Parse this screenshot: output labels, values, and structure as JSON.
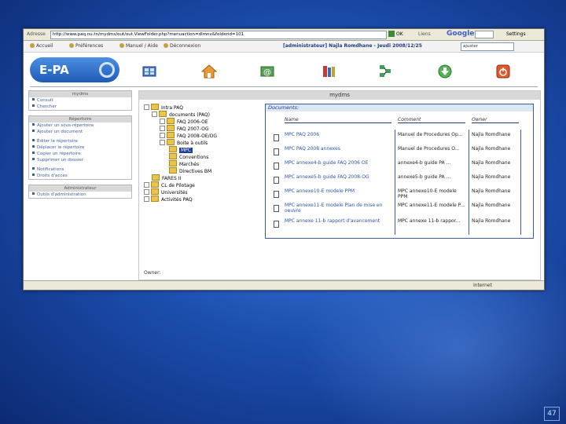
{
  "browser": {
    "address_label": "Adresse",
    "url": "http://www.paq.nu.tn/mydms/out/out.ViewFolder.php?menuaction=dlmnv&folderid=101",
    "go_label": "OK",
    "links_label": "Liens",
    "google_label": "Google",
    "settings_label": "Settings"
  },
  "navbar": {
    "items": [
      "Accueil",
      "Préférences",
      "Manuel / Aide",
      "Déconnexion"
    ],
    "user_text": "[administrateur] Najla Romdhane - Jeudi 2008/12/25",
    "select_value": "ajuster"
  },
  "banner": {
    "logo_text": "E-PA",
    "icons": [
      "grid-icon",
      "home-icon",
      "mail-icon",
      "network-icon",
      "download-icon",
      "power-icon"
    ]
  },
  "sidebar": {
    "sections": [
      {
        "title": "mydms",
        "items": [
          "Consult",
          "Chercher"
        ]
      },
      {
        "title": "Répertoire",
        "items": [
          "Ajouter un sous-répertoire",
          "Ajouter un document",
          "Éditer le répertoire",
          "Déplacer le répertoire",
          "Copier un répertoire",
          "Supprimer un dossier",
          "Notifications",
          "Droits d'accès"
        ]
      },
      {
        "title": "Administrateur",
        "items": [
          "Outils d'administration"
        ]
      }
    ]
  },
  "main": {
    "title": "mydms",
    "tree": [
      "Intra PAQ",
      "documents (PAQ)",
      "FAQ 2006-OE",
      "FAQ 2007-OG",
      "FAQ 2008-OE/OG",
      "Boite à outils",
      "MPC",
      "Conventions",
      "Marchés",
      "Directives BM",
      "FARES II",
      "CL de Pilotage",
      "Universités",
      "Activités PAQ"
    ],
    "owner_label": "Owner:",
    "docs_header": "Documents:",
    "columns": {
      "name": "Name",
      "comment": "Comment",
      "owner": "Owner"
    },
    "documents": [
      {
        "name": "MPC PAQ 2006",
        "comment": "Manuel de Procedures Op...",
        "owner": "Najla Romdhane"
      },
      {
        "name": "MPC PAQ 2008 annexes",
        "comment": "Manuel de Procedures O...",
        "owner": "Najla Romdhane"
      },
      {
        "name": "MPC annexe4-b guide FAQ 2006 OE",
        "comment": "annexe4-b guide PA ...",
        "owner": "Najla Romdhane"
      },
      {
        "name": "MPC annexe5-b guide FAQ 2008-OG",
        "comment": "annexe5-b guide PA ...",
        "owner": "Najla Romdhane"
      },
      {
        "name": "MPC annexe10-E modele PPM",
        "comment": "MPC annexe10-E modele PPM",
        "owner": "Najla Romdhane"
      },
      {
        "name": "MPC annexe11-E modele Plan de mise en oeuvre",
        "comment": "MPC annexe11-E modele P...",
        "owner": "Najla Romdhane"
      },
      {
        "name": "MPC annexe 11-b rapport d'avancement",
        "comment": "MPC annexe 11-b rappor...",
        "owner": "Najla Romdhane"
      }
    ]
  },
  "status": {
    "zone": "Internet"
  },
  "slide": {
    "page_number": "47"
  },
  "colors": {
    "accent": "#1c3f94",
    "link": "#2a55b0",
    "folder": "#e8c44a",
    "background": "#1c4fb0"
  }
}
